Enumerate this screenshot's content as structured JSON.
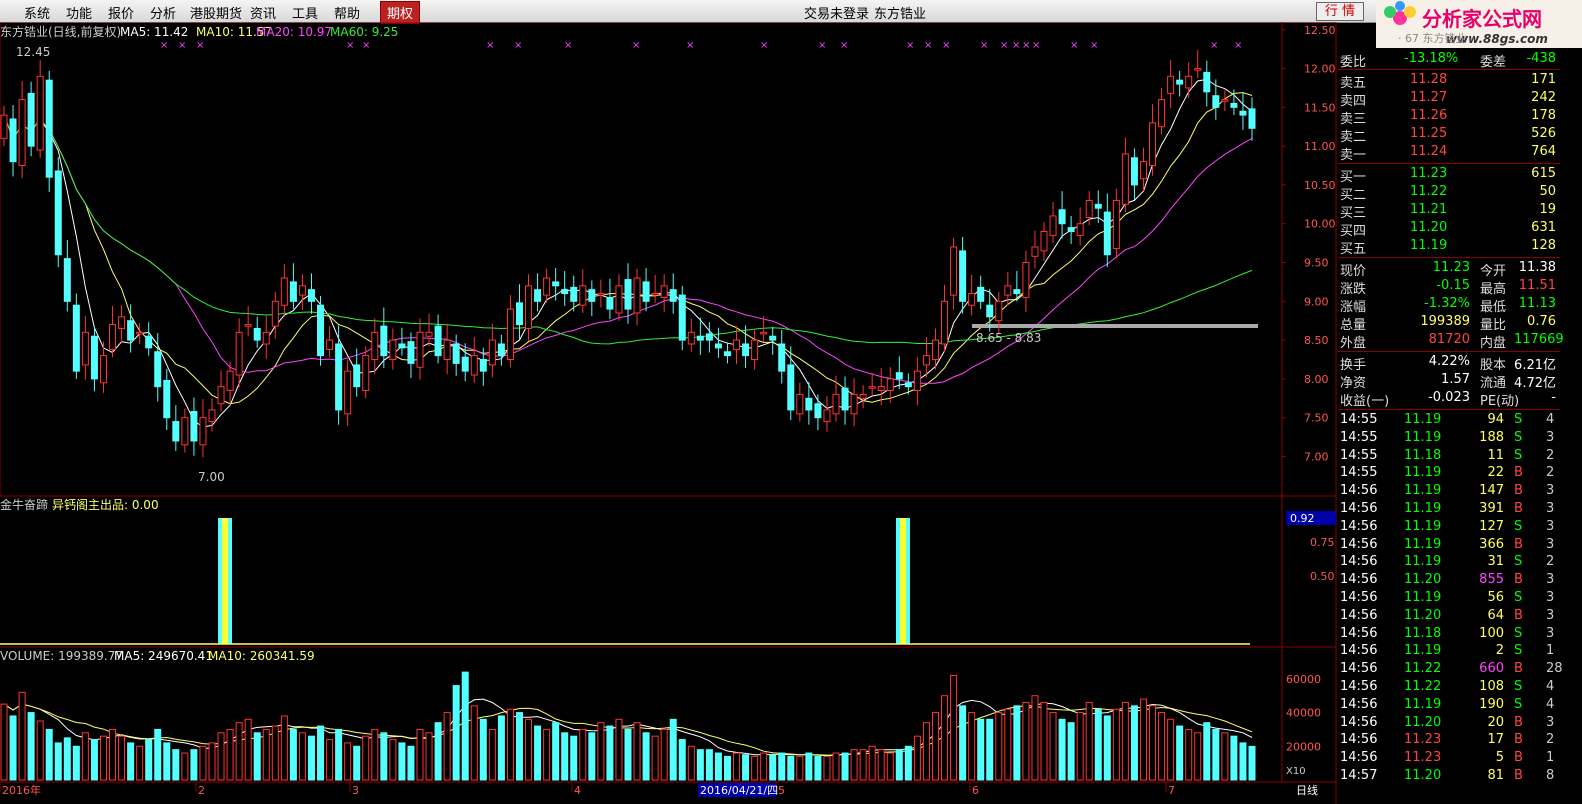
{
  "menu": {
    "items": [
      "系统",
      "功能",
      "报价",
      "分析",
      "港股期货",
      "资讯",
      "工具",
      "帮助"
    ],
    "active_item": "期权",
    "login_status": "交易未登录",
    "stock_name": "东方锆业",
    "hangqing_button": "行 情"
  },
  "logo": {
    "text": "分析家公式网",
    "url_text": "www.88gs.com"
  },
  "price_chart": {
    "title": "东方锆业(日线,前复权)",
    "ma_labels": [
      {
        "label": "MA5: 11.42",
        "color": "#ffffff"
      },
      {
        "label": "MA10: 11.57",
        "color": "#ffff66"
      },
      {
        "label": "MA20: 10.97",
        "color": "#ff44ff"
      },
      {
        "label": "MA60: 9.25",
        "color": "#33ee33"
      }
    ],
    "high_label": "12.45",
    "low_label": "7.00",
    "range_label": "8.65 - 8.83",
    "ylim": [
      6.8,
      12.6
    ],
    "yticks": [
      "12.50",
      "12.00",
      "11.50",
      "11.00",
      "10.50",
      "10.00",
      "9.50",
      "9.00",
      "8.50",
      "8.00",
      "7.50",
      "7.00"
    ]
  },
  "indicator": {
    "name": "金牛奋蹄",
    "sub_label": "异钙阁主出品: 0.00",
    "value_box": "0.92",
    "yticks": [
      "0.75",
      "0.50"
    ]
  },
  "volume": {
    "label": "VOLUME: 199389.77",
    "ma5": "MA5: 249670.41",
    "ma10": "MA10: 260341.59",
    "yticks": [
      "60000",
      "40000",
      "20000"
    ],
    "unit": "X10"
  },
  "timeline": {
    "labels": [
      "2016年",
      "2",
      "3",
      "4",
      "5",
      "6",
      "7"
    ],
    "cursor_date": "2016/04/21/四",
    "period": "日线"
  },
  "panel": {
    "top_code": "· 67 东方锆业",
    "weibi": {
      "label": "委比",
      "value": "-13.18%",
      "label2": "委差",
      "value2": "-438"
    },
    "sell": [
      {
        "label": "卖五",
        "price": "11.28",
        "vol": "171"
      },
      {
        "label": "卖四",
        "price": "11.27",
        "vol": "242"
      },
      {
        "label": "卖三",
        "price": "11.26",
        "vol": "178"
      },
      {
        "label": "卖二",
        "price": "11.25",
        "vol": "526"
      },
      {
        "label": "卖一",
        "price": "11.24",
        "vol": "764"
      }
    ],
    "buy": [
      {
        "label": "买一",
        "price": "11.23",
        "vol": "615"
      },
      {
        "label": "买二",
        "price": "11.22",
        "vol": "50"
      },
      {
        "label": "买三",
        "price": "11.21",
        "vol": "19"
      },
      {
        "label": "买四",
        "price": "11.20",
        "vol": "631"
      },
      {
        "label": "买五",
        "price": "11.19",
        "vol": "128"
      }
    ],
    "quote": [
      {
        "l1": "现价",
        "v1": "11.23",
        "c1": "#00ff00",
        "l2": "今开",
        "v2": "11.38",
        "c2": "#ffffff"
      },
      {
        "l1": "涨跌",
        "v1": "-0.15",
        "c1": "#00ff00",
        "l2": "最高",
        "v2": "11.51",
        "c2": "#ff4444"
      },
      {
        "l1": "涨幅",
        "v1": "-1.32%",
        "c1": "#00ff00",
        "l2": "最低",
        "v2": "11.13",
        "c2": "#00ff00"
      },
      {
        "l1": "总量",
        "v1": "199389",
        "c1": "#ffff66",
        "l2": "量比",
        "v2": "0.76",
        "c2": "#ffff66"
      },
      {
        "l1": "外盘",
        "v1": "81720",
        "c1": "#ff4444",
        "l2": "内盘",
        "v2": "117669",
        "c2": "#00ff00"
      }
    ],
    "finance": [
      {
        "l1": "换手",
        "v1": "4.22%",
        "l2": "股本",
        "v2": "6.21亿"
      },
      {
        "l1": "净资",
        "v1": "1.57",
        "l2": "流通",
        "v2": "4.72亿"
      },
      {
        "l1": "收益(一)",
        "v1": "-0.023",
        "l2": "PE(动)",
        "v2": "-"
      }
    ],
    "ticks": [
      {
        "t": "14:55",
        "p": "11.19",
        "v": "94",
        "s": "S",
        "n": "4"
      },
      {
        "t": "14:55",
        "p": "11.19",
        "v": "188",
        "s": "S",
        "n": "3"
      },
      {
        "t": "14:55",
        "p": "11.18",
        "v": "11",
        "s": "S",
        "n": "2"
      },
      {
        "t": "14:55",
        "p": "11.19",
        "v": "22",
        "s": "B",
        "n": "2"
      },
      {
        "t": "14:56",
        "p": "11.19",
        "v": "147",
        "s": "B",
        "n": "3"
      },
      {
        "t": "14:56",
        "p": "11.19",
        "v": "391",
        "s": "B",
        "n": "3"
      },
      {
        "t": "14:56",
        "p": "11.19",
        "v": "127",
        "s": "S",
        "n": "3"
      },
      {
        "t": "14:56",
        "p": "11.19",
        "v": "366",
        "s": "B",
        "n": "3"
      },
      {
        "t": "14:56",
        "p": "11.19",
        "v": "31",
        "s": "S",
        "n": "2"
      },
      {
        "t": "14:56",
        "p": "11.20",
        "v": "855",
        "s": "B",
        "n": "3"
      },
      {
        "t": "14:56",
        "p": "11.19",
        "v": "56",
        "s": "S",
        "n": "3"
      },
      {
        "t": "14:56",
        "p": "11.20",
        "v": "64",
        "s": "B",
        "n": "3"
      },
      {
        "t": "14:56",
        "p": "11.18",
        "v": "100",
        "s": "S",
        "n": "3"
      },
      {
        "t": "14:56",
        "p": "11.19",
        "v": "2",
        "s": "S",
        "n": "1"
      },
      {
        "t": "14:56",
        "p": "11.22",
        "v": "660",
        "s": "B",
        "n": "28"
      },
      {
        "t": "14:56",
        "p": "11.22",
        "v": "108",
        "s": "S",
        "n": "4"
      },
      {
        "t": "14:56",
        "p": "11.19",
        "v": "190",
        "s": "S",
        "n": "4"
      },
      {
        "t": "14:56",
        "p": "11.20",
        "v": "20",
        "s": "B",
        "n": "3"
      },
      {
        "t": "14:56",
        "p": "11.23",
        "v": "17",
        "s": "B",
        "n": "2"
      },
      {
        "t": "14:56",
        "p": "11.23",
        "v": "5",
        "s": "B",
        "n": "1"
      },
      {
        "t": "14:57",
        "p": "11.20",
        "v": "81",
        "s": "B",
        "n": "8"
      }
    ]
  },
  "colors": {
    "up": "#ff3333",
    "down": "#54ffff",
    "grid": "#8b0000",
    "ma5": "#ffffff",
    "ma10": "#ffff66",
    "ma20": "#ff44ff",
    "ma60": "#33ee33"
  },
  "chart_data": {
    "type": "candlestick",
    "closes": [
      11.4,
      10.8,
      11.6,
      11.0,
      11.9,
      10.6,
      9.6,
      9.0,
      8.1,
      8.6,
      8.0,
      8.3,
      8.7,
      8.8,
      8.5,
      8.6,
      8.4,
      7.9,
      7.5,
      7.2,
      7.5,
      7.2,
      7.5,
      7.6,
      7.9,
      8.1,
      8.6,
      8.7,
      8.5,
      8.6,
      9.0,
      9.3,
      9.0,
      9.2,
      9.0,
      8.3,
      8.5,
      7.6,
      8.1,
      7.9,
      8.3,
      8.6,
      8.3,
      8.5,
      8.4,
      8.2,
      8.6,
      8.6,
      8.3,
      8.5,
      8.2,
      8.1,
      8.3,
      8.1,
      8.5,
      8.3,
      8.9,
      8.7,
      9.2,
      9.0,
      9.3,
      9.2,
      9.1,
      9.0,
      9.2,
      9.0,
      9.1,
      8.9,
      9.2,
      8.9,
      9.3,
      9.0,
      9.1,
      9.2,
      9.0,
      8.5,
      8.6,
      8.5,
      8.5,
      8.4,
      8.3,
      8.5,
      8.3,
      8.5,
      8.6,
      8.5,
      8.1,
      7.6,
      7.8,
      7.6,
      7.5,
      7.6,
      7.8,
      7.6,
      7.8,
      7.8,
      7.9,
      7.9,
      8.0,
      8.0,
      7.9,
      8.1,
      8.3,
      8.5,
      9.0,
      9.7,
      9.0,
      9.1,
      9.0,
      8.8,
      9.0,
      9.2,
      9.1,
      9.5,
      9.7,
      9.9,
      10.1,
      10.0,
      9.9,
      10.0,
      10.3,
      10.2,
      9.6,
      10.3,
      10.9,
      10.5,
      10.8,
      11.3,
      11.6,
      11.9,
      11.8,
      11.9,
      12.0,
      11.7,
      11.5,
      11.6,
      11.5,
      11.4,
      11.23
    ],
    "volumes_x10": [
      45000,
      38000,
      52000,
      40000,
      35000,
      30000,
      22000,
      25000,
      20000,
      28000,
      24000,
      26000,
      30000,
      26000,
      22000,
      20000,
      24000,
      30000,
      22000,
      18000,
      16000,
      18000,
      20000,
      22000,
      28000,
      30000,
      34000,
      36000,
      28000,
      30000,
      32000,
      38000,
      30000,
      28000,
      26000,
      32000,
      24000,
      30000,
      22000,
      20000,
      26000,
      30000,
      28000,
      24000,
      22000,
      20000,
      30000,
      28000,
      34000,
      40000,
      56000,
      64000,
      44000,
      36000,
      30000,
      38000,
      42000,
      40000,
      36000,
      32000,
      30000,
      34000,
      28000,
      26000,
      30000,
      28000,
      34000,
      32000,
      36000,
      30000,
      34000,
      28000,
      26000,
      30000,
      36000,
      24000,
      20000,
      18000,
      18000,
      16000,
      14000,
      16000,
      15000,
      14000,
      16000,
      15000,
      16000,
      14000,
      14000,
      16000,
      14000,
      14000,
      16000,
      16000,
      18000,
      18000,
      20000,
      18000,
      16000,
      18000,
      20000,
      26000,
      34000,
      40000,
      50000,
      62000,
      44000,
      40000,
      36000,
      36000,
      40000,
      42000,
      44000,
      46000,
      50000,
      46000,
      40000,
      36000,
      34000,
      40000,
      46000,
      42000,
      38000,
      42000,
      46000,
      44000,
      48000,
      44000,
      40000,
      36000,
      32000,
      30000,
      28000,
      34000,
      30000,
      28000,
      26000,
      22000,
      19939
    ],
    "indicator_signal_indices": [
      21,
      108
    ]
  }
}
